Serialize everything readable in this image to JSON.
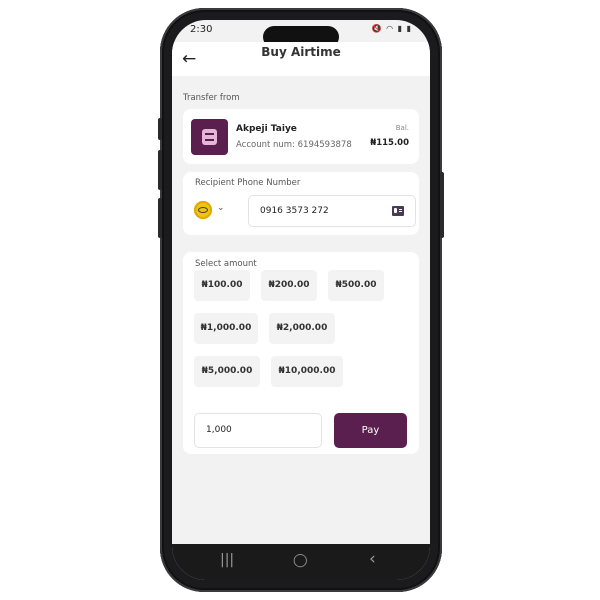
{
  "status_bar": {
    "time": "2:30",
    "icons": "🔇 ◠ ▮ ▮"
  },
  "header": {
    "title": "Buy Airtime",
    "back_icon": "arrow-left-icon"
  },
  "transfer_from": {
    "label": "Transfer from",
    "account_name": "Akpeji Taiye",
    "account_number": "Account num: 6194593878",
    "balance_label": "Bal.",
    "balance_value": "₦115.00"
  },
  "recipient": {
    "label": "Recipient Phone Number",
    "phone_value": "0916 3573 272",
    "network_icon": "network-logo-icon",
    "contact_icon": "contact-card-icon"
  },
  "amounts": {
    "label": "Select amount",
    "options": [
      "₦100.00",
      "₦200.00",
      "₦500.00",
      "₦1,000.00",
      "₦2,000.00",
      "₦5,000.00",
      "₦10,000.00"
    ],
    "custom_value": "1,000",
    "pay_label": "Pay"
  },
  "nav_bar": {
    "recents": "|||",
    "home": "◯",
    "back": "‹"
  },
  "colors": {
    "brand": "#5a1f4e",
    "background": "#f2f2f2"
  }
}
